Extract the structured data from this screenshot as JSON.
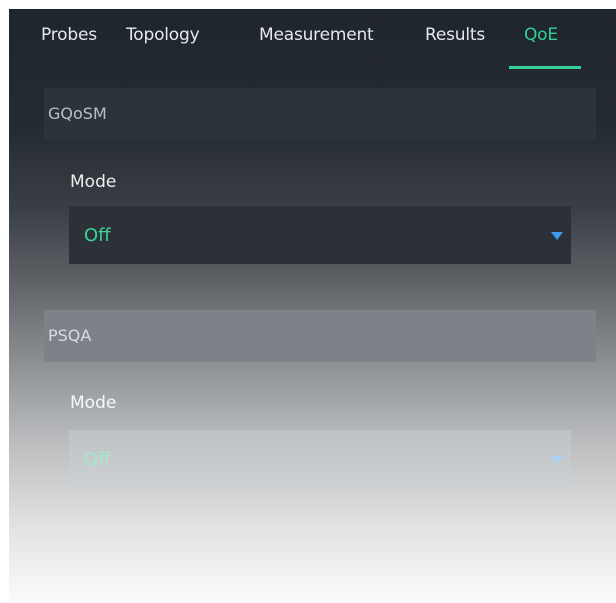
{
  "tabs": [
    {
      "label": "Probes"
    },
    {
      "label": "Topology"
    },
    {
      "label": "Measurement"
    },
    {
      "label": "Results"
    },
    {
      "label": "QoE",
      "active": true
    }
  ],
  "sections": {
    "gqosm": {
      "title": "GQoSM",
      "mode_label": "Mode",
      "mode_value": "Off"
    },
    "psqa": {
      "title": "PSQA",
      "mode_label": "Mode",
      "mode_value": "Off"
    }
  },
  "colors": {
    "accent": "#34d096",
    "dropdown_arrow": "#3d9bf0",
    "panel_dark": "#1f252c"
  },
  "icons": {
    "dropdown": "triangle-down-icon"
  }
}
